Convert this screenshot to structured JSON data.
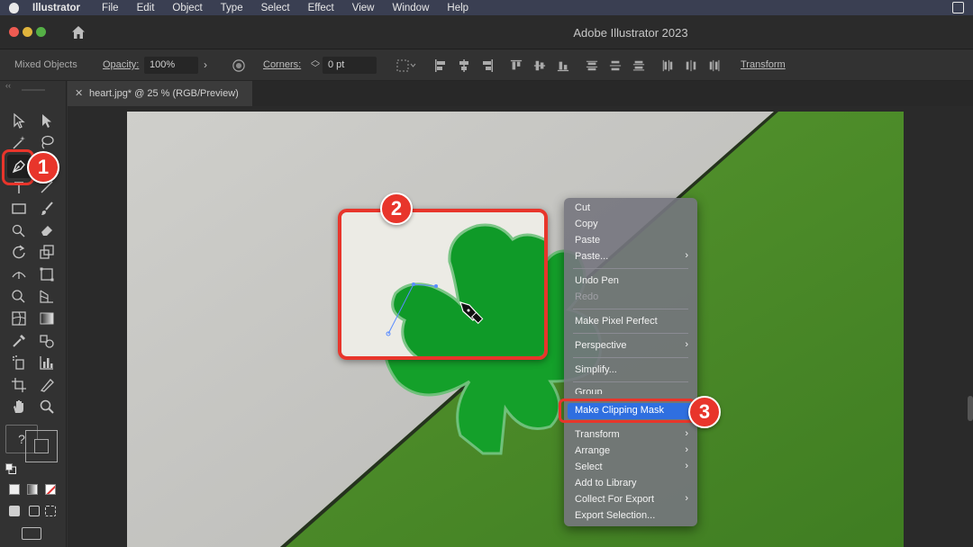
{
  "menubar": {
    "items": [
      "Illustrator",
      "File",
      "Edit",
      "Object",
      "Type",
      "Select",
      "Effect",
      "View",
      "Window",
      "Help"
    ]
  },
  "titlebar": {
    "title": "Adobe Illustrator 2023"
  },
  "controlbar": {
    "selection": "Mixed Objects",
    "opacity_label": "Opacity:",
    "opacity_value": "100%",
    "corners_label": "Corners:",
    "corners_value": "0 pt",
    "transform_label": "Transform"
  },
  "document_tab": {
    "title": "heart.jpg* @ 25 % (RGB/Preview)",
    "close_glyph": "✕"
  },
  "context_menu": {
    "items": [
      {
        "label": "Cut",
        "submenu": false,
        "disabled": false
      },
      {
        "label": "Copy",
        "submenu": false,
        "disabled": false
      },
      {
        "label": "Paste",
        "submenu": false,
        "disabled": false
      },
      {
        "label": "Paste...",
        "submenu": true,
        "disabled": false
      },
      {
        "label": "Undo Pen",
        "submenu": false,
        "disabled": false
      },
      {
        "label": "Redo",
        "submenu": false,
        "disabled": true
      },
      {
        "label": "Make Pixel Perfect",
        "submenu": false,
        "disabled": false
      },
      {
        "label": "Perspective",
        "submenu": true,
        "disabled": false
      },
      {
        "label": "Simplify...",
        "submenu": false,
        "disabled": false
      },
      {
        "label": "Group",
        "submenu": false,
        "disabled": false
      },
      {
        "label": "Make Clipping Mask",
        "submenu": false,
        "disabled": false,
        "selected": true
      },
      {
        "label": "Transform",
        "submenu": true,
        "disabled": false
      },
      {
        "label": "Arrange",
        "submenu": true,
        "disabled": false
      },
      {
        "label": "Select",
        "submenu": true,
        "disabled": false
      },
      {
        "label": "Add to Library",
        "submenu": false,
        "disabled": false
      },
      {
        "label": "Collect For Export",
        "submenu": true,
        "disabled": false
      },
      {
        "label": "Export Selection...",
        "submenu": false,
        "disabled": false
      }
    ]
  },
  "callouts": {
    "step1": "1",
    "step2": "2",
    "step3": "3"
  },
  "toolbar": {
    "fill_stroke_question": "?"
  },
  "colors": {
    "menubar": "#3a3f52",
    "titlebar": "#2b2b2b",
    "panel": "#323232",
    "accent_red": "#e8352b",
    "menu_highlight": "#2f6fe0",
    "shamrock_green": "#14a02a",
    "background_green": "#4f8a2a",
    "background_gray": "#c6c6c2"
  },
  "icons": [
    "apple-icon",
    "home-icon",
    "pen-tool-icon",
    "selection-tool-icon",
    "direct-selection-icon",
    "close-icon"
  ]
}
